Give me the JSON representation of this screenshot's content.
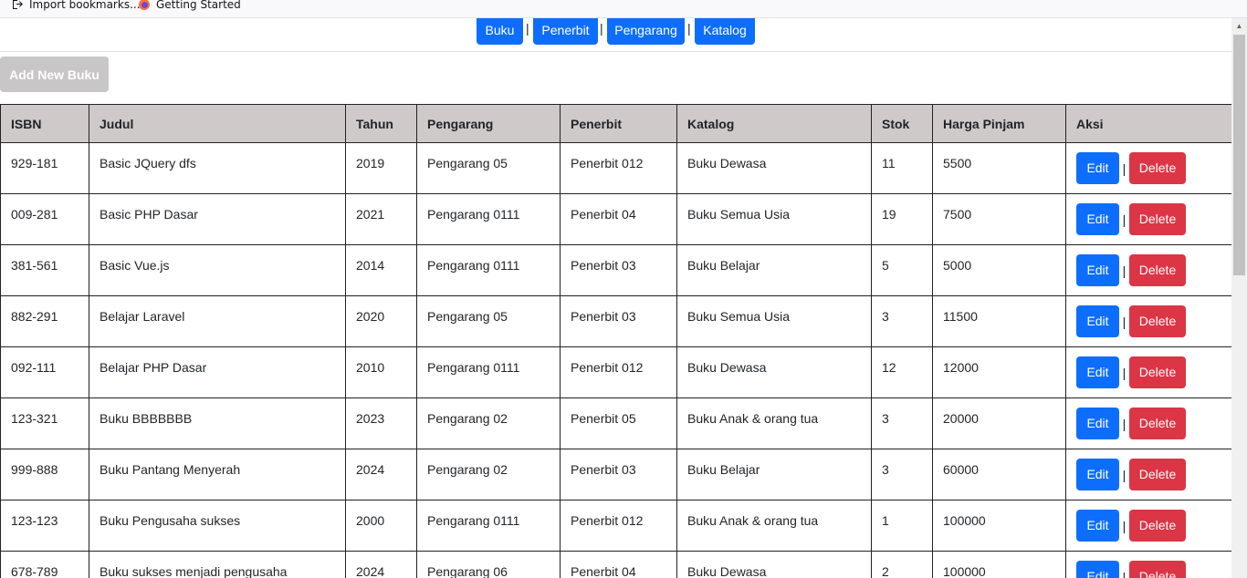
{
  "browser": {
    "bookmarks": [
      {
        "label": "Import bookmarks...",
        "icon": "import-icon"
      },
      {
        "label": "Getting Started",
        "icon": "firefox-icon"
      }
    ]
  },
  "nav": {
    "items": [
      {
        "label": "Buku"
      },
      {
        "label": "Penerbit"
      },
      {
        "label": "Pengarang"
      },
      {
        "label": "Katalog"
      }
    ],
    "separator": "|"
  },
  "add_button": "Add New Buku",
  "table": {
    "headers": [
      "ISBN",
      "Judul",
      "Tahun",
      "Pengarang",
      "Penerbit",
      "Katalog",
      "Stok",
      "Harga Pinjam",
      "Aksi"
    ],
    "rows": [
      [
        "929-181",
        "Basic JQuery dfs",
        "2019",
        "Pengarang 05",
        "Penerbit 012",
        "Buku Dewasa",
        "11",
        "5500"
      ],
      [
        "009-281",
        "Basic PHP Dasar",
        "2021",
        "Pengarang 0111",
        "Penerbit 04",
        "Buku Semua Usia",
        "19",
        "7500"
      ],
      [
        "381-561",
        "Basic Vue.js",
        "2014",
        "Pengarang 0111",
        "Penerbit 03",
        "Buku Belajar",
        "5",
        "5000"
      ],
      [
        "882-291",
        "Belajar Laravel",
        "2020",
        "Pengarang 05",
        "Penerbit 03",
        "Buku Semua Usia",
        "3",
        "11500"
      ],
      [
        "092-111",
        "Belajar PHP Dasar",
        "2010",
        "Pengarang 0111",
        "Penerbit 012",
        "Buku Dewasa",
        "12",
        "12000"
      ],
      [
        "123-321",
        "Buku BBBBBBB",
        "2023",
        "Pengarang 02",
        "Penerbit 05",
        "Buku Anak & orang tua",
        "3",
        "20000"
      ],
      [
        "999-888",
        "Buku Pantang Menyerah",
        "2024",
        "Pengarang 02",
        "Penerbit 03",
        "Buku Belajar",
        "3",
        "60000"
      ],
      [
        "123-123",
        "Buku Pengusaha sukses",
        "2000",
        "Pengarang 0111",
        "Penerbit 012",
        "Buku Anak & orang tua",
        "1",
        "100000"
      ],
      [
        "678-789",
        "Buku sukses menjadi pengusaha",
        "2024",
        "Pengarang 06",
        "Penerbit 04",
        "Buku Dewasa",
        "2",
        "100000"
      ]
    ],
    "edit_label": "Edit",
    "delete_label": "Delete",
    "action_separator": "|"
  },
  "colors": {
    "primary": "#0d6efd",
    "danger": "#dc3545",
    "header_bg": "#cfc9c9",
    "add_button_bg": "#c8c6c6"
  }
}
